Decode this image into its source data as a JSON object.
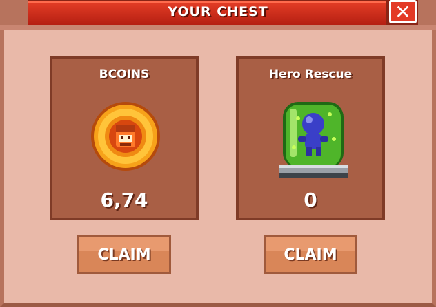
{
  "header": {
    "title": "YOUR CHEST",
    "close_icon": "close-icon"
  },
  "rewards": [
    {
      "title": "BCOINS",
      "value": "6,74",
      "icon": "bcoin-icon",
      "claim_label": "CLAIM"
    },
    {
      "title": "Hero Rescue",
      "value": "0",
      "icon": "hero-rescue-jar-icon",
      "claim_label": "CLAIM"
    }
  ],
  "colors": {
    "title_bar": "#e23c25",
    "panel_bg": "#e9b9a9",
    "card_bg": "#a95f45",
    "claim_button": "#e89a6f"
  }
}
